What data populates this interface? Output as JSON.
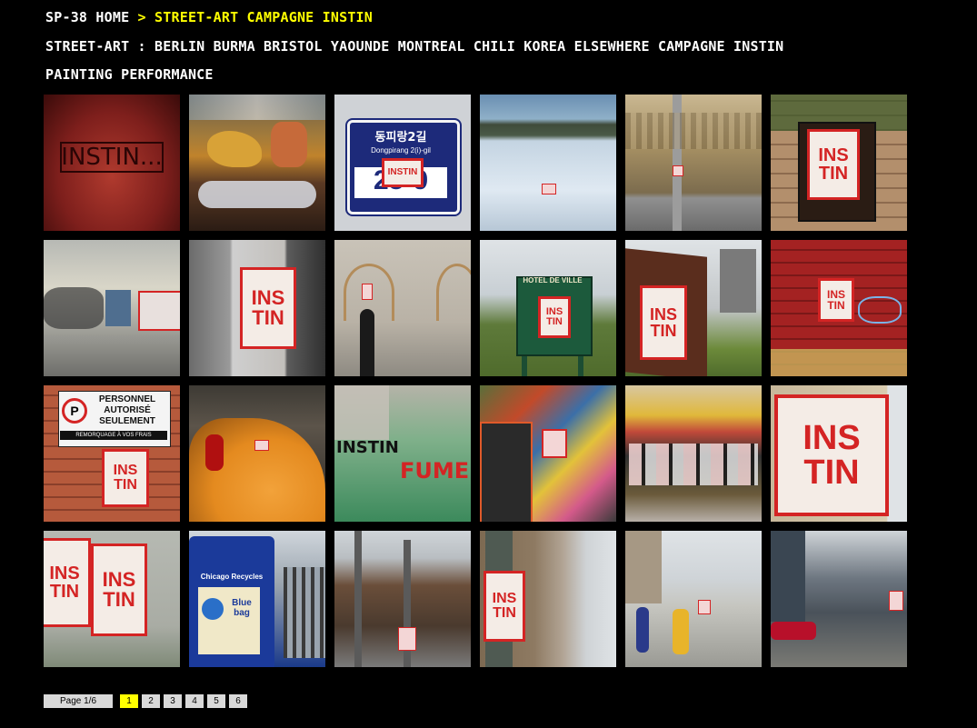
{
  "breadcrumb": {
    "home": "SP-38 HOME",
    "separator": ">",
    "current": "STREET-ART CAMPAGNE INSTIN"
  },
  "nav": {
    "section": "STREET-ART",
    "colon": ":",
    "links": [
      "BERLIN",
      "BURMA",
      "BRISTOL",
      "YAOUNDE",
      "MONTREAL",
      "CHILI",
      "KOREA",
      "ELSEWHERE",
      "CAMPAGNE INSTIN"
    ],
    "links2": [
      "PAINTING",
      "PERFORMANCE"
    ]
  },
  "thumbnails": [
    {
      "name": "thumb-instin-red-wall",
      "tag": "INSTIN...",
      "tag2": ""
    },
    {
      "name": "thumb-temple-interior",
      "tag": "",
      "tag2": ""
    },
    {
      "name": "thumb-korean-street-sign",
      "tag": "INSTIN",
      "tag2": "동피랑2길",
      "sign_sub": "Dongpirang 2(i)-gil",
      "sign_num": "25-9"
    },
    {
      "name": "thumb-snowy-path",
      "tag": "",
      "tag2": ""
    },
    {
      "name": "thumb-dresden-mural-pole",
      "tag": "",
      "tag2": ""
    },
    {
      "name": "thumb-instin-box-brick",
      "tag": "INS",
      "tag2": "TIN"
    },
    {
      "name": "thumb-graffiti-building",
      "tag": "",
      "tag2": ""
    },
    {
      "name": "thumb-instin-pillar",
      "tag": "INS",
      "tag2": "TIN"
    },
    {
      "name": "thumb-man-in-hat",
      "tag": "",
      "tag2": ""
    },
    {
      "name": "thumb-hotel-de-ville-sign",
      "tag": "INS",
      "tag2": "TIN",
      "sign": "HOTEL DE VILLE"
    },
    {
      "name": "thumb-instin-utility-box",
      "tag": "INS",
      "tag2": "TIN"
    },
    {
      "name": "thumb-instin-red-brick",
      "tag": "INS",
      "tag2": "TIN"
    },
    {
      "name": "thumb-personnel-autorise-sign",
      "tag": "INS",
      "tag2": "TIN",
      "sign": "PERSONNEL AUTORISÉ SEULEMENT",
      "sign_sub": "REMORQUAGE À VOS FRAIS"
    },
    {
      "name": "thumb-yellow-taxi",
      "tag": "",
      "tag2": ""
    },
    {
      "name": "thumb-instin-fume-graffiti",
      "tag": "INSTIN",
      "tag2": "FUME"
    },
    {
      "name": "thumb-graffiti-wall-colorful",
      "tag": "",
      "tag2": ""
    },
    {
      "name": "thumb-graffiti-wall-mixed",
      "tag": "",
      "tag2": ""
    },
    {
      "name": "thumb-instin-large-poster",
      "tag": "INS",
      "tag2": "TIN"
    },
    {
      "name": "thumb-instin-posters-wall",
      "tag": "INS",
      "tag2": "TIN"
    },
    {
      "name": "thumb-chicago-recycles-bin",
      "tag": "",
      "tag2": "",
      "sign": "Chicago Recycles",
      "sign_sub": "Blue bag"
    },
    {
      "name": "thumb-city-street",
      "tag": "",
      "tag2": ""
    },
    {
      "name": "thumb-instin-lamp-post",
      "tag": "INS",
      "tag2": "TIN"
    },
    {
      "name": "thumb-construction-workers",
      "tag": "",
      "tag2": ""
    },
    {
      "name": "thumb-city-skyline-street",
      "tag": "",
      "tag2": ""
    }
  ],
  "pager": {
    "label": "Page 1/6",
    "pages": [
      "1",
      "2",
      "3",
      "4",
      "5",
      "6"
    ],
    "active": "1"
  }
}
